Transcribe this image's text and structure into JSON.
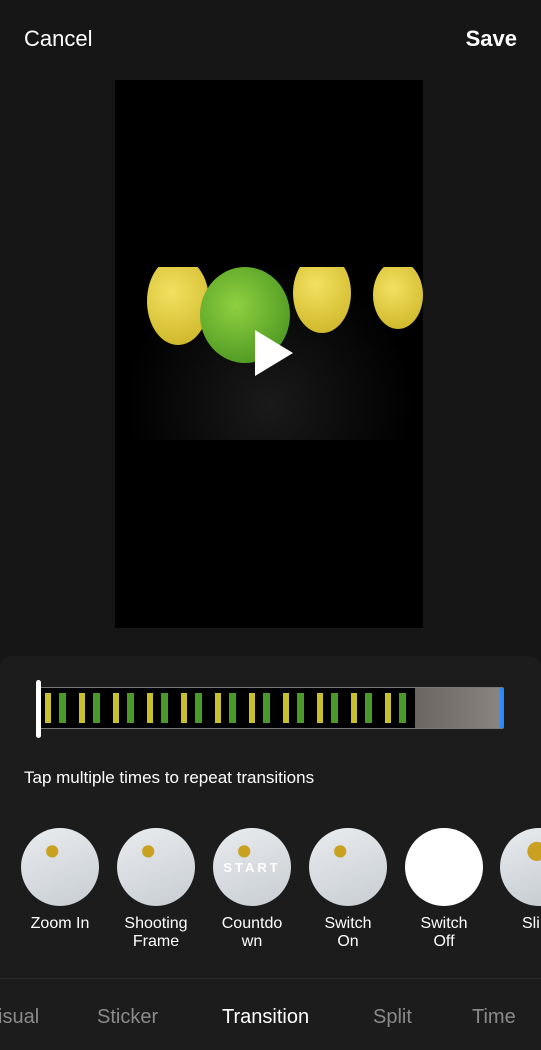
{
  "header": {
    "cancel": "Cancel",
    "save": "Save"
  },
  "preview": {
    "state": "paused"
  },
  "hint": "Tap multiple times to repeat transitions",
  "transitions": [
    {
      "label": "Zoom In"
    },
    {
      "label": "Shooting Frame"
    },
    {
      "label": "Countdown",
      "overlay": "START"
    },
    {
      "label": "Switch On"
    },
    {
      "label": "Switch Off"
    },
    {
      "label": "Sli"
    }
  ],
  "tabs": [
    {
      "label": "isual"
    },
    {
      "label": "Sticker"
    },
    {
      "label": "Transition",
      "active": true
    },
    {
      "label": "Split"
    },
    {
      "label": "Time"
    }
  ],
  "colors": {
    "accent": "#2a8cff",
    "background": "#161616"
  }
}
